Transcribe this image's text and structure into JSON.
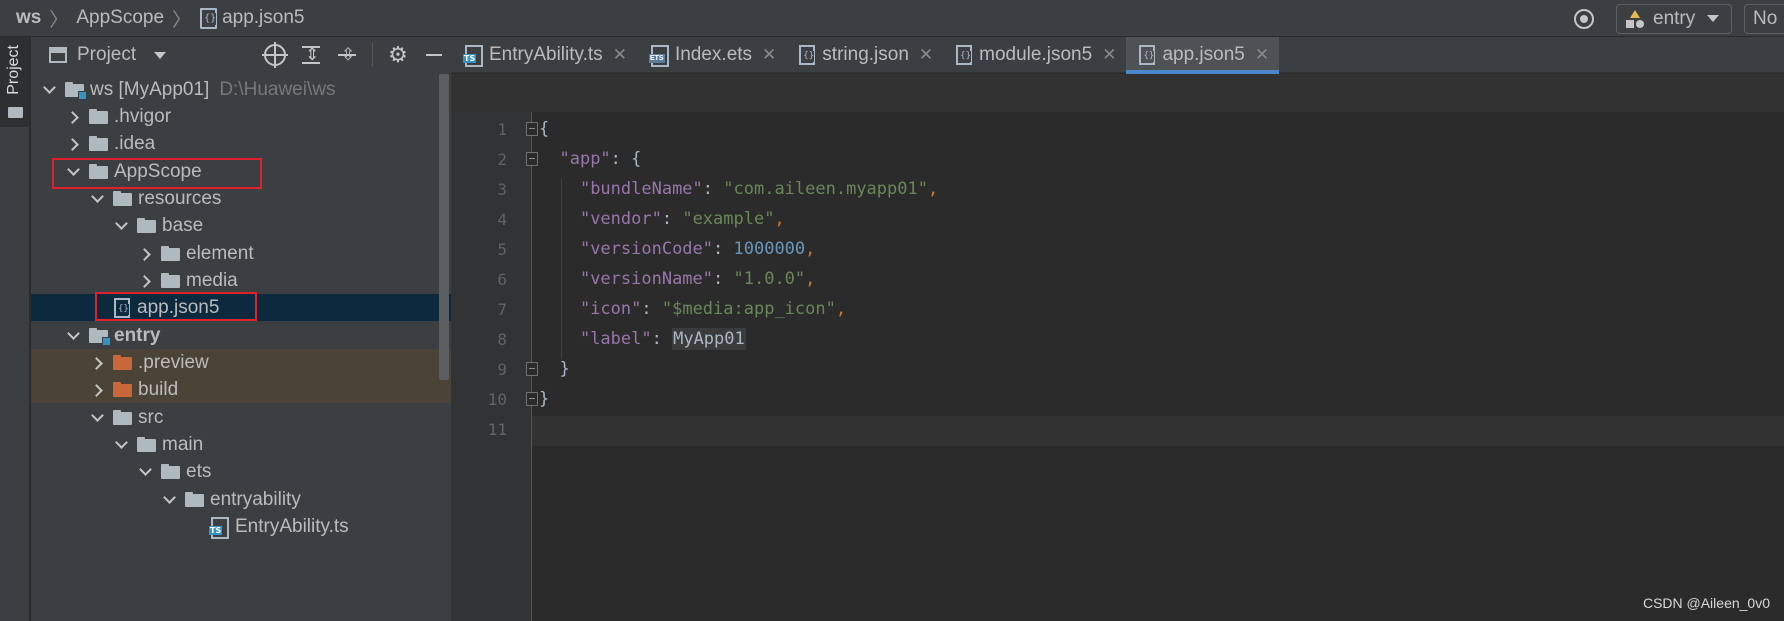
{
  "breadcrumb": {
    "root": "ws",
    "folder": "AppScope",
    "file": "app.json5",
    "sep": "〉"
  },
  "toolbar": {
    "run_config": "entry",
    "cut_label": "No"
  },
  "side_strip": {
    "project_tab": "Project"
  },
  "project_panel": {
    "title": "Project",
    "tree": [
      {
        "label": "ws [MyApp01]",
        "suffix": "D:\\Huawei\\ws"
      },
      {
        "label": ".hvigor"
      },
      {
        "label": ".idea"
      },
      {
        "label": "AppScope"
      },
      {
        "label": "resources"
      },
      {
        "label": "base"
      },
      {
        "label": "element"
      },
      {
        "label": "media"
      },
      {
        "label": "app.json5"
      },
      {
        "label": "entry"
      },
      {
        "label": ".preview"
      },
      {
        "label": "build"
      },
      {
        "label": "src"
      },
      {
        "label": "main"
      },
      {
        "label": "ets"
      },
      {
        "label": "entryability"
      },
      {
        "label": "EntryAbility.ts"
      }
    ]
  },
  "tabs": [
    {
      "label": "EntryAbility.ts",
      "icon": "ts-file-icon"
    },
    {
      "label": "Index.ets",
      "icon": "ets-file-icon"
    },
    {
      "label": "string.json",
      "icon": "json-file-icon"
    },
    {
      "label": "module.json5",
      "icon": "json-file-icon"
    },
    {
      "label": "app.json5",
      "icon": "json-file-icon",
      "active": true
    }
  ],
  "editor": {
    "line_numbers": [
      "1",
      "2",
      "3",
      "4",
      "5",
      "6",
      "7",
      "8",
      "9",
      "10",
      "11"
    ],
    "code": {
      "l1": "{",
      "l2_key": "\"app\"",
      "l2_rest": ": {",
      "l3_key": "\"bundleName\"",
      "l3_val": "\"com.aileen.myapp01\"",
      "l4_key": "\"vendor\"",
      "l4_val": "\"example\"",
      "l5_key": "\"versionCode\"",
      "l5_val": "1000000",
      "l6_key": "\"versionName\"",
      "l6_val": "\"1.0.0\"",
      "l7_key": "\"icon\"",
      "l7_val": "\"$media:app_icon\"",
      "l8_key": "\"label\"",
      "l8_val": "MyApp01",
      "l9": "}",
      "l10": "}",
      "colon": ": ",
      "comma": ","
    }
  },
  "watermark": "CSDN @Aileen_0v0",
  "colors": {
    "accent": "#4a88c7",
    "highlight_box": "#e0202a",
    "selection": "#0d293e"
  }
}
